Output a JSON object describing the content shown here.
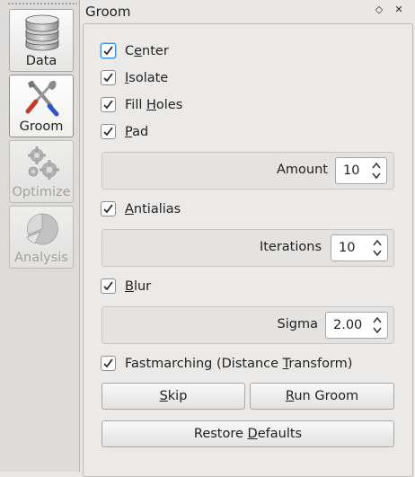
{
  "sidebar": {
    "tools": [
      {
        "label": "Data",
        "icon": "database-icon",
        "state": "enabled"
      },
      {
        "label": "Groom",
        "icon": "tools-icon",
        "state": "active"
      },
      {
        "label": "Optimize",
        "icon": "gears-icon",
        "state": "disabled"
      },
      {
        "label": "Analysis",
        "icon": "pie-chart-icon",
        "state": "disabled"
      }
    ]
  },
  "dock": {
    "title": "Groom",
    "float_glyph": "◇",
    "close_glyph": "✕"
  },
  "groom": {
    "center": {
      "pre": "C",
      "u": "e",
      "post": "nter",
      "checked": true
    },
    "isolate": {
      "pre": "",
      "u": "I",
      "post": "solate",
      "checked": true
    },
    "fill_holes": {
      "pre": "Fill ",
      "u": "H",
      "post": "oles",
      "checked": true
    },
    "pad": {
      "pre": "",
      "u": "P",
      "post": "ad",
      "checked": true
    },
    "amount": {
      "label": "Amount",
      "value": "10"
    },
    "antialias": {
      "pre": "",
      "u": "A",
      "post": "ntialias",
      "checked": true
    },
    "iterations": {
      "label": "Iterations",
      "value": "10"
    },
    "blur": {
      "pre": "",
      "u": "B",
      "post": "lur",
      "checked": true
    },
    "sigma": {
      "label": "Sigma",
      "value": "2.00"
    },
    "fastmarching": {
      "pre": "Fastmarching (Distance ",
      "u": "T",
      "post": "ransform)",
      "checked": true
    },
    "skip": {
      "pre": "",
      "u": "S",
      "post": "kip"
    },
    "run": {
      "pre": "",
      "u": "R",
      "post": "un Groom"
    },
    "restore": {
      "pre": "Restore ",
      "u": "D",
      "post": "efaults"
    }
  },
  "colors": {
    "check": "#2b2b2b",
    "focus": "#3d8ee0"
  }
}
